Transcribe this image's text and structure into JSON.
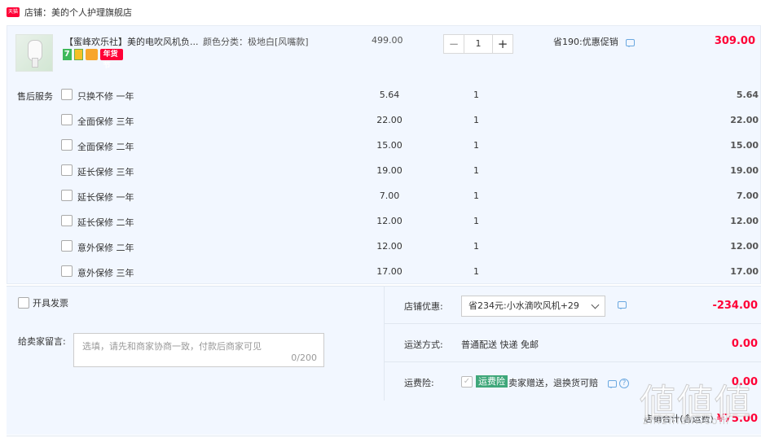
{
  "shop": {
    "logo_text": "天猫",
    "name": "店铺：美的个人护理旗舰店"
  },
  "product": {
    "title": "【蜜峰欢乐社】美的电吹风机负...",
    "badge_new": "年货节",
    "badge_7": "7",
    "spec": "颜色分类：极地白[风嘴款]",
    "unit_price": "499.00",
    "quantity": "1",
    "qty_minus": "−",
    "qty_plus": "+",
    "promo": "省190:优惠促销",
    "total": "309.00"
  },
  "services": {
    "label": "售后服务",
    "items": [
      {
        "name": "只换不修 一年",
        "price": "5.64",
        "qty": "1",
        "total": "5.64"
      },
      {
        "name": "全面保修 三年",
        "price": "22.00",
        "qty": "1",
        "total": "22.00"
      },
      {
        "name": "全面保修 二年",
        "price": "15.00",
        "qty": "1",
        "total": "15.00"
      },
      {
        "name": "延长保修 三年",
        "price": "19.00",
        "qty": "1",
        "total": "19.00"
      },
      {
        "name": "延长保修 一年",
        "price": "7.00",
        "qty": "1",
        "total": "7.00"
      },
      {
        "name": "延长保修 二年",
        "price": "12.00",
        "qty": "1",
        "total": "12.00"
      },
      {
        "name": "意外保修 二年",
        "price": "12.00",
        "qty": "1",
        "total": "12.00"
      },
      {
        "name": "意外保修 三年",
        "price": "17.00",
        "qty": "1",
        "total": "17.00"
      }
    ]
  },
  "invoice": {
    "label": "开具发票"
  },
  "message": {
    "label": "给卖家留言:",
    "placeholder": "选填，请先和商家协商一致，付款后商家可见",
    "count": "0/200"
  },
  "shop_discount": {
    "label": "店铺优惠:",
    "selected": "省234元:小水滴吹风机+29",
    "amount": "-234.00"
  },
  "shipping": {
    "label": "运送方式:",
    "value": "普通配送 快递 免邮",
    "amount": "0.00"
  },
  "insurance": {
    "label": "运费险:",
    "check": "✓",
    "badge": "运费险",
    "text": "卖家赠送，退换货可赔",
    "help": "?",
    "amount": "0.00"
  },
  "grand_total": {
    "label": "店铺合计(含运费)",
    "amount": "¥75.00"
  },
  "watermark": {
    "big": "値値値",
    "small": "zhizhizhi.com"
  },
  "colors": {
    "accent": "#ff0036",
    "panel_bg": "#f2f7ff",
    "insurance_green": "#3fa77a"
  }
}
